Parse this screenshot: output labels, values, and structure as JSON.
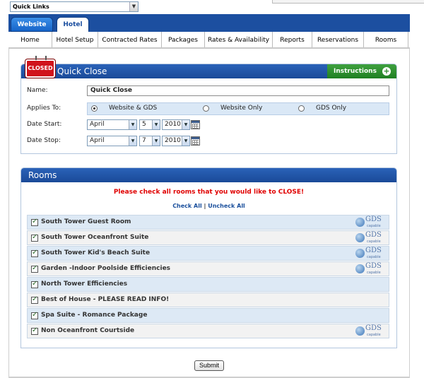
{
  "quick_links": {
    "selected": "Quick Links"
  },
  "tabs": [
    {
      "label": "Website",
      "active": false
    },
    {
      "label": "Hotel",
      "active": true
    }
  ],
  "nav": [
    {
      "label": "Home"
    },
    {
      "label": "Hotel Setup"
    },
    {
      "label": "Contracted Rates"
    },
    {
      "label": "Packages"
    },
    {
      "label": "Rates & Availability"
    },
    {
      "label": "Reports"
    },
    {
      "label": "Reservations"
    },
    {
      "label": "Rooms"
    }
  ],
  "quick_close": {
    "sign_text": "CLOSED",
    "title": "Quick Close",
    "instructions_label": "Instructions",
    "name_label": "Name:",
    "name_value": "Quick Close",
    "applies_label": "Applies To:",
    "applies_options": [
      "Website & GDS",
      "Website Only",
      "GDS Only"
    ],
    "applies_selected": "Website & GDS",
    "date_start_label": "Date Start:",
    "date_start": {
      "month": "April",
      "day": "5",
      "year": "2010"
    },
    "date_stop_label": "Date Stop:",
    "date_stop": {
      "month": "April",
      "day": "7",
      "year": "2010"
    }
  },
  "rooms": {
    "title": "Rooms",
    "message": "Please check all rooms that you would like to CLOSE!",
    "check_all": "Check All",
    "separator": "|",
    "uncheck_all": "Uncheck All",
    "gds_text": "GDS",
    "gds_sub": "capable",
    "items": [
      {
        "label": "South Tower Guest Room",
        "checked": true,
        "gds": true
      },
      {
        "label": "South Tower Oceanfront Suite",
        "checked": true,
        "gds": true
      },
      {
        "label": "South Tower Kid's Beach Suite",
        "checked": true,
        "gds": true
      },
      {
        "label": "Garden -Indoor Poolside Efficiencies",
        "checked": true,
        "gds": true
      },
      {
        "label": "North Tower Efficiencies",
        "checked": true,
        "gds": false
      },
      {
        "label": "Best of House - PLEASE READ INFO!",
        "checked": true,
        "gds": false
      },
      {
        "label": "Spa Suite - Romance Package",
        "checked": true,
        "gds": false
      },
      {
        "label": "Non Oceanfront Courtside",
        "checked": true,
        "gds": true
      }
    ]
  },
  "submit_label": "Submit",
  "colors": {
    "header_blue": "#1c4fa0",
    "instructions_green": "#2b8a2b",
    "message_red": "#e00000",
    "closed_red": "#d0141c"
  }
}
